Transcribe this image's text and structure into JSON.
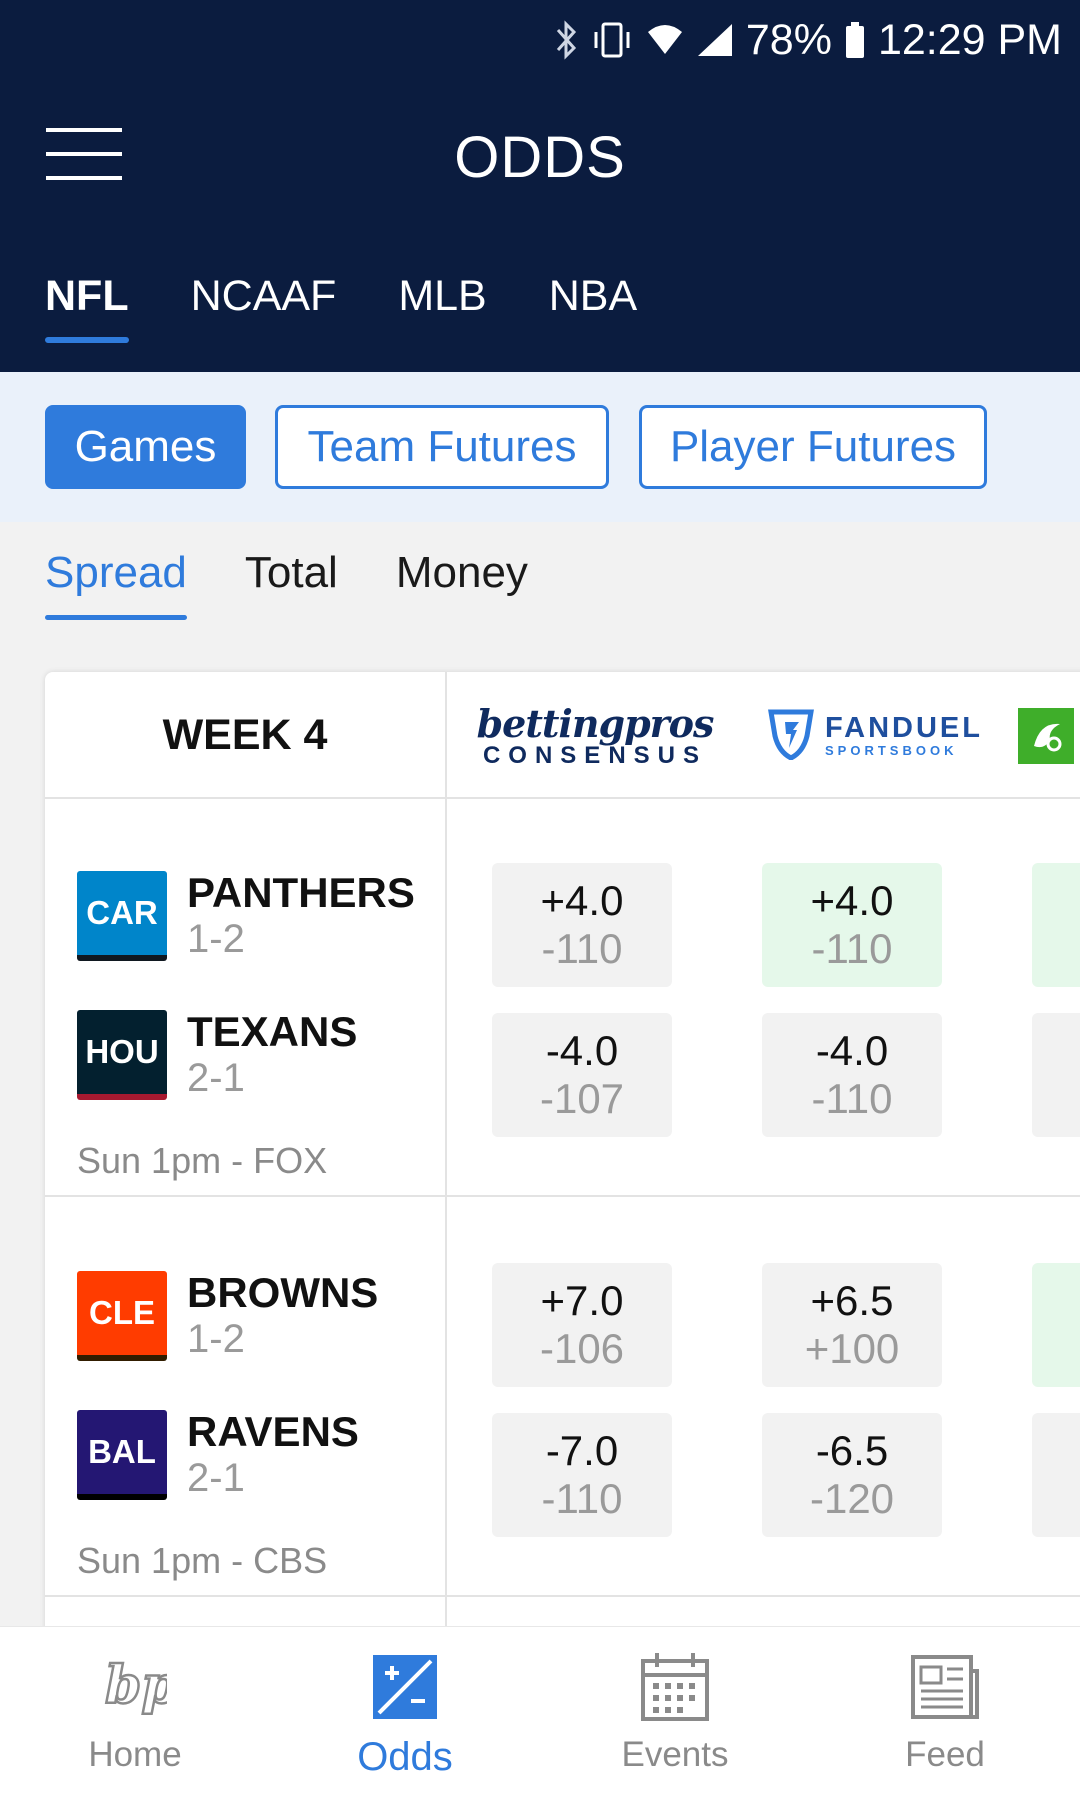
{
  "status_bar": {
    "battery": "78%",
    "time": "12:29 PM",
    "icons": [
      "bluetooth-icon",
      "vibrate-icon",
      "wifi-icon",
      "signal-icon",
      "battery-icon"
    ]
  },
  "header": {
    "title": "ODDS",
    "league_tabs": [
      {
        "label": "NFL",
        "active": true
      },
      {
        "label": "NCAAF",
        "active": false
      },
      {
        "label": "MLB",
        "active": false
      },
      {
        "label": "NBA",
        "active": false
      }
    ]
  },
  "segments": [
    {
      "label": "Games",
      "active": true
    },
    {
      "label": "Team Futures",
      "active": false
    },
    {
      "label": "Player Futures",
      "active": false
    }
  ],
  "bet_tabs": [
    {
      "label": "Spread",
      "active": true
    },
    {
      "label": "Total",
      "active": false
    },
    {
      "label": "Money",
      "active": false
    }
  ],
  "table": {
    "week_label": "WEEK 4",
    "books": [
      {
        "line1": "bettingpros",
        "line2": "CONSENSUS"
      },
      {
        "line1": "FANDUEL",
        "line2": "SPORTSBOOK"
      },
      {
        "name": "draftkings-logo"
      }
    ],
    "games": [
      {
        "time": "Sun 1pm - FOX",
        "teams": [
          {
            "abbr": "CAR",
            "name": "PANTHERS",
            "record": "1-2",
            "color": "#0085ca",
            "stripe": "#101820",
            "odds": [
              {
                "line": "+4.0",
                "price": "-110",
                "best": false
              },
              {
                "line": "+4.0",
                "price": "-110",
                "best": true
              },
              {
                "best": true
              }
            ]
          },
          {
            "abbr": "HOU",
            "name": "TEXANS",
            "record": "2-1",
            "color": "#03202f",
            "stripe": "#a71930",
            "odds": [
              {
                "line": "-4.0",
                "price": "-107",
                "best": false
              },
              {
                "line": "-4.0",
                "price": "-110",
                "best": false
              },
              {
                "best": false
              }
            ]
          }
        ]
      },
      {
        "time": "Sun 1pm - CBS",
        "teams": [
          {
            "abbr": "CLE",
            "name": "BROWNS",
            "record": "1-2",
            "color": "#ff3c00",
            "stripe": "#311d00",
            "odds": [
              {
                "line": "+7.0",
                "price": "-106",
                "best": false
              },
              {
                "line": "+6.5",
                "price": "+100",
                "best": false
              },
              {
                "best": true
              }
            ]
          },
          {
            "abbr": "BAL",
            "name": "RAVENS",
            "record": "2-1",
            "color": "#241773",
            "stripe": "#000000",
            "odds": [
              {
                "line": "-7.0",
                "price": "-110",
                "best": false
              },
              {
                "line": "-6.5",
                "price": "-120",
                "best": false
              },
              {
                "best": false
              }
            ]
          }
        ]
      }
    ]
  },
  "bottom_nav": [
    {
      "label": "Home",
      "icon": "bp-logo-icon",
      "active": false
    },
    {
      "label": "Odds",
      "icon": "odds-icon",
      "active": true
    },
    {
      "label": "Events",
      "icon": "calendar-icon",
      "active": false
    },
    {
      "label": "Feed",
      "icon": "newspaper-icon",
      "active": false
    }
  ]
}
